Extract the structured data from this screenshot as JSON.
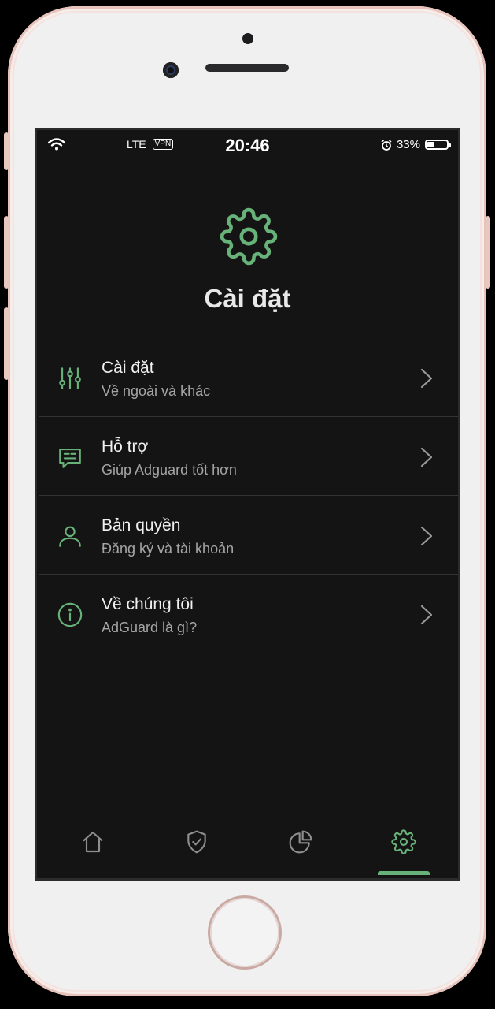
{
  "status_bar": {
    "network": "LTE",
    "vpn": "VPN",
    "time": "20:46",
    "battery": "33%",
    "battery_level": 0.33
  },
  "colors": {
    "accent": "#67b279",
    "background": "#141414",
    "text_primary": "#f0f0f0",
    "text_secondary": "#a5a5a5",
    "tab_inactive": "#8e8e8e"
  },
  "page": {
    "title": "Cài đặt",
    "icon": "gear-icon"
  },
  "menu": [
    {
      "icon": "sliders-icon",
      "title": "Cài đặt",
      "subtitle": "Về ngoài và khác"
    },
    {
      "icon": "chat-icon",
      "title": "Hỗ trợ",
      "subtitle": "Giúp Adguard tốt hơn"
    },
    {
      "icon": "user-icon",
      "title": "Bản quyền",
      "subtitle": "Đăng ký và tài khoản"
    },
    {
      "icon": "info-icon",
      "title": "Về chúng tôi",
      "subtitle": "AdGuard là gì?"
    }
  ],
  "tabs": [
    {
      "icon": "home-icon",
      "active": false
    },
    {
      "icon": "shield-check-icon",
      "active": false
    },
    {
      "icon": "pie-chart-icon",
      "active": false
    },
    {
      "icon": "gear-icon",
      "active": true
    }
  ]
}
